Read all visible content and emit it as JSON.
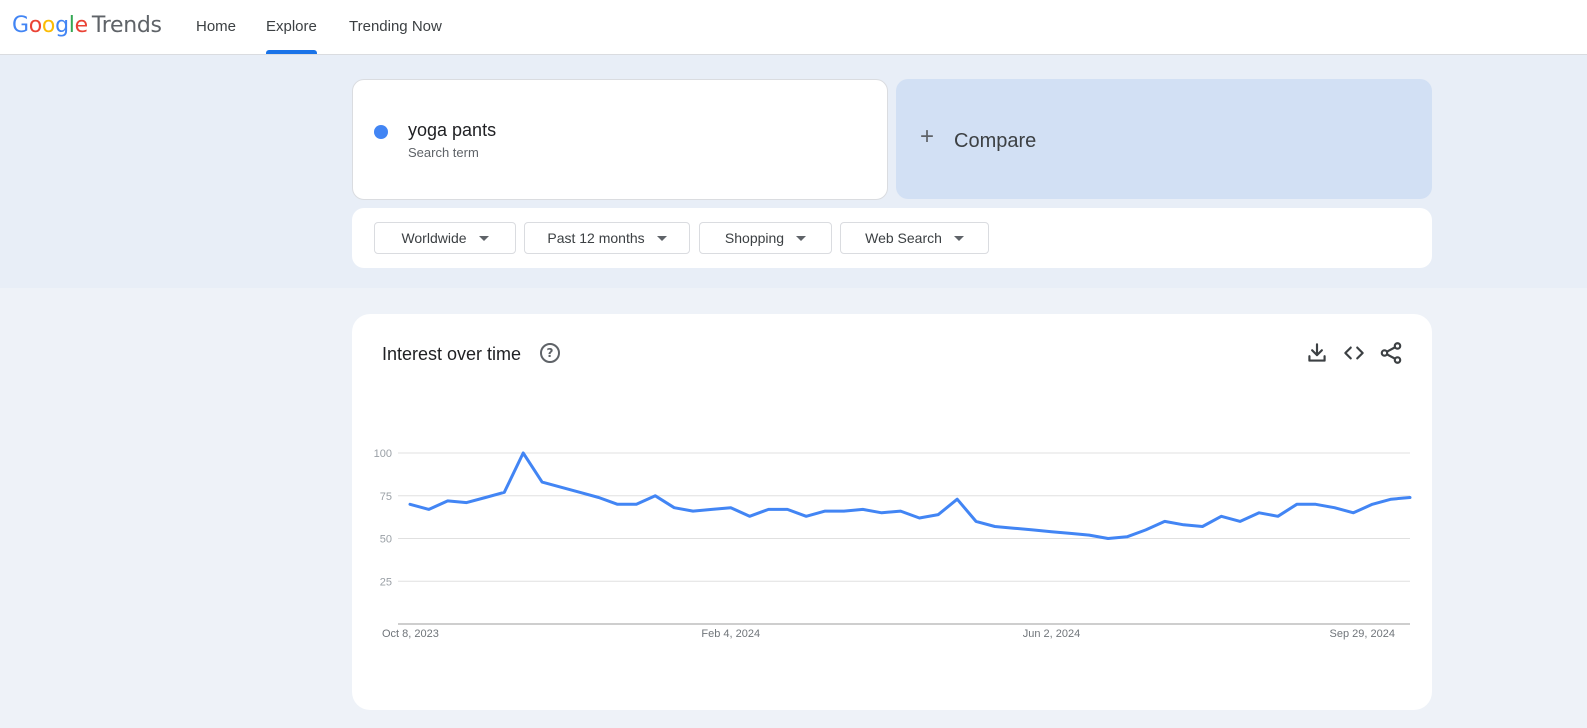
{
  "header": {
    "logo_google": "Google",
    "logo_trends": "Trends",
    "nav": [
      {
        "label": "Home"
      },
      {
        "label": "Explore",
        "active": true
      },
      {
        "label": "Trending Now"
      }
    ]
  },
  "search": {
    "term": "yoga pants",
    "term_type": "Search term",
    "term_color": "#4285f4",
    "compare_label": "Compare"
  },
  "filters": [
    {
      "label": "Worldwide"
    },
    {
      "label": "Past 12 months"
    },
    {
      "label": "Shopping"
    },
    {
      "label": "Web Search"
    }
  ],
  "panel": {
    "title": "Interest over time",
    "icons": [
      "help-icon",
      "download-icon",
      "embed-icon",
      "share-icon"
    ]
  },
  "chart_data": {
    "type": "line",
    "series": [
      {
        "color": "#4285f4",
        "values": [
          70,
          67,
          72,
          71,
          74,
          77,
          100,
          83,
          80,
          77,
          74,
          70,
          70,
          75,
          68,
          66,
          67,
          68,
          63,
          67,
          67,
          63,
          66,
          66,
          67,
          65,
          66,
          62,
          64,
          73,
          60,
          57,
          56,
          55,
          54,
          53,
          52,
          50,
          51,
          55,
          60,
          58,
          57,
          63,
          60,
          65,
          63,
          70,
          70,
          68,
          65,
          70,
          73,
          74
        ]
      }
    ],
    "x_tick_labels": [
      "Oct 8, 2023",
      "Feb 4, 2024",
      "Jun 2, 2024",
      "Sep 29, 2024"
    ],
    "x_tick_indices": [
      0,
      17,
      34,
      51
    ],
    "y_ticks": [
      25,
      50,
      75,
      100
    ],
    "ylim": [
      0,
      100
    ],
    "grid": true,
    "accent_color": "#4285f4"
  }
}
